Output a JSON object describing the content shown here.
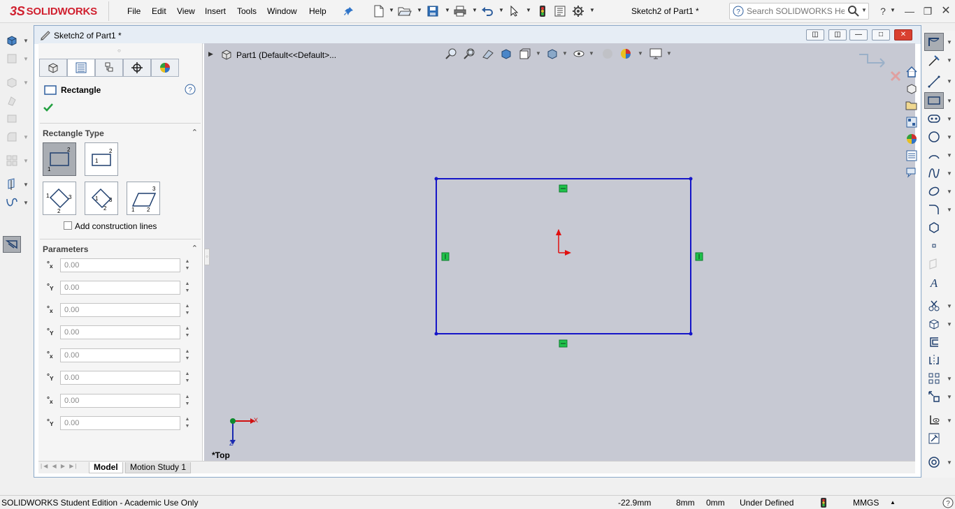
{
  "app": {
    "logo_text": "SOLIDWORKS",
    "logo_mark": "3S"
  },
  "menu": [
    "File",
    "Edit",
    "View",
    "Insert",
    "Tools",
    "Window",
    "Help"
  ],
  "doc_title": "Sketch2 of Part1 *",
  "search": {
    "placeholder": "Search SOLIDWORKS Help"
  },
  "window": {
    "title": "Sketch2 of Part1 *"
  },
  "feature_tree": {
    "item": "Part1  (Default<<Default>..."
  },
  "property_manager": {
    "title": "Rectangle",
    "rectangle_type": {
      "heading": "Rectangle Type",
      "add_construction_lines": "Add construction lines",
      "add_construction_lines_checked": false
    },
    "parameters": {
      "heading": "Parameters",
      "rows": [
        {
          "axis": "x",
          "value": "0.00"
        },
        {
          "axis": "Y",
          "value": "0.00"
        },
        {
          "axis": "x",
          "value": "0.00"
        },
        {
          "axis": "Y",
          "value": "0.00"
        },
        {
          "axis": "x",
          "value": "0.00"
        },
        {
          "axis": "Y",
          "value": "0.00"
        },
        {
          "axis": "x",
          "value": "0.00"
        },
        {
          "axis": "Y",
          "value": "0.00"
        }
      ]
    }
  },
  "viewport": {
    "view_label": "*Top",
    "triad_x": "X",
    "triad_y": "Z"
  },
  "bottom_tabs": [
    "Model",
    "Motion Study 1"
  ],
  "status": {
    "edition": "SOLIDWORKS Student Edition - Academic Use Only",
    "x_coord": "-22.9mm",
    "y_coord": "8mm",
    "z_coord": "0mm",
    "sketch_state": "Under Defined",
    "units": "MMGS"
  },
  "colors": {
    "sketch_line": "#1515c8",
    "relation_marker": "#1fc24a",
    "origin_arrow": "#e01010",
    "graphics_bg": "#c7c9d3",
    "accent": "#d0202f"
  }
}
